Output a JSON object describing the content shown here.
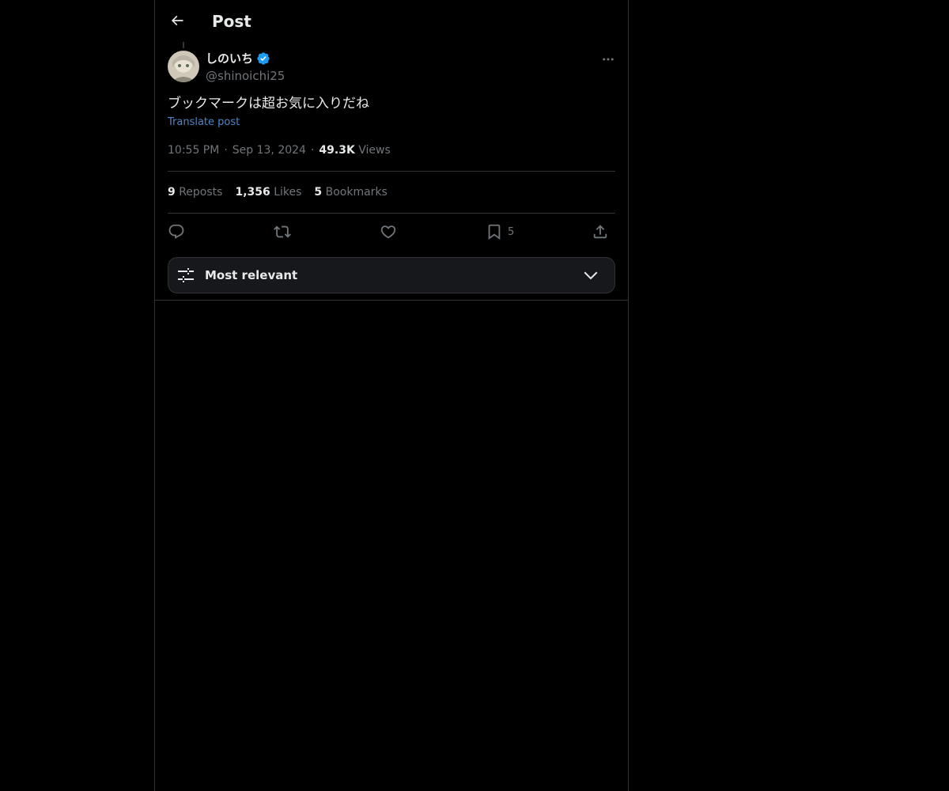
{
  "header": {
    "title": "Post"
  },
  "author": {
    "display_name": "しのいち",
    "handle": "@shinoichi25",
    "verified": true
  },
  "post": {
    "text": "ブックマークは超お気に入りだね",
    "translate_label": "Translate post",
    "time": "10:55 PM",
    "date": "Sep 13, 2024",
    "views_count": "49.3K",
    "views_label": "Views"
  },
  "stats": {
    "reposts_count": "9",
    "reposts_label": "Reposts",
    "likes_count": "1,356",
    "likes_label": "Likes",
    "bookmarks_count": "5",
    "bookmarks_label": "Bookmarks"
  },
  "actions": {
    "reply_icon": "reply-icon",
    "repost_icon": "repost-icon",
    "like_icon": "heart-icon",
    "bookmark_icon": "bookmark-icon",
    "bookmark_count": "5",
    "share_icon": "share-icon"
  },
  "sort": {
    "label": "Most relevant"
  },
  "colors": {
    "background": "#000000",
    "text": "#e7e9ea",
    "muted": "#71767b",
    "link": "#4f86c6",
    "verified": "#1d9bf0",
    "border": "#2f3336"
  }
}
